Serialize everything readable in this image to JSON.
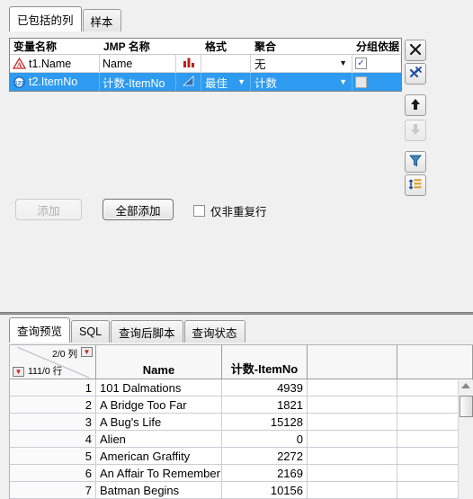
{
  "top_panel": {
    "tabs": [
      {
        "label": "已包括的列",
        "active": true
      },
      {
        "label": "样本",
        "active": false
      }
    ],
    "column_grid": {
      "headers": {
        "variable_name": "变量名称",
        "jmp_name": "JMP 名称",
        "icon": "",
        "format": "格式",
        "aggregate": "聚合",
        "group_by": "分组依据"
      },
      "rows": [
        {
          "type_icon": "nominal-character-icon",
          "variable_name": "t1.Name",
          "jmp_name": "Name",
          "dist_icon": "bar-histogram-icon",
          "format": "",
          "aggregate": "无",
          "group_by_checked": true,
          "selected": false
        },
        {
          "type_icon": "continuous-numeric-icon",
          "variable_name": "t2.ItemNo",
          "jmp_name": "计数-ItemNo",
          "dist_icon": "triangle-distribution-icon",
          "format": "最佳",
          "aggregate": "计数",
          "group_by_checked": false,
          "selected": true
        }
      ]
    },
    "side_buttons": [
      {
        "name": "remove-column-button",
        "icon": "x-icon",
        "disabled": false
      },
      {
        "name": "remove-all-columns-button",
        "icon": "x-multi-icon",
        "disabled": false
      },
      {
        "name": "move-up-button",
        "icon": "arrow-up-icon",
        "disabled": false
      },
      {
        "name": "move-down-button",
        "icon": "arrow-down-icon",
        "disabled": true
      },
      {
        "name": "filter-button",
        "icon": "funnel-icon",
        "disabled": false
      },
      {
        "name": "sort-button",
        "icon": "sort-icon",
        "disabled": false
      }
    ],
    "actions": {
      "add_label": "添加",
      "add_disabled": true,
      "add_all_label": "全部添加",
      "distinct_only_label": "仅非重复行",
      "distinct_only_checked": false
    }
  },
  "bottom_panel": {
    "tabs": [
      {
        "label": "查询预览",
        "active": true
      },
      {
        "label": "SQL",
        "active": false
      },
      {
        "label": "查询后脚本",
        "active": false
      },
      {
        "label": "查询状态",
        "active": false
      }
    ],
    "table": {
      "corner": {
        "columns_text": "2/0 列",
        "rows_text": "111/0 行"
      },
      "headers": [
        "Name",
        "计数-ItemNo",
        "",
        ""
      ],
      "rows": [
        {
          "n": "1",
          "name": "101 Dalmations",
          "count": "4939",
          "e1": "",
          "e2": ""
        },
        {
          "n": "2",
          "name": "A Bridge Too Far",
          "count": "1821",
          "e1": "",
          "e2": ""
        },
        {
          "n": "3",
          "name": "A Bug's Life",
          "count": "15128",
          "e1": "",
          "e2": ""
        },
        {
          "n": "4",
          "name": "Alien",
          "count": "0",
          "e1": "",
          "e2": ""
        },
        {
          "n": "5",
          "name": "American Graffity",
          "count": "2272",
          "e1": "",
          "e2": ""
        },
        {
          "n": "6",
          "name": "An Affair To Remember",
          "count": "2169",
          "e1": "",
          "e2": ""
        },
        {
          "n": "7",
          "name": "Batman Begins",
          "count": "10156",
          "e1": "",
          "e2": ""
        }
      ]
    }
  },
  "colors": {
    "selection_blue": "#2e9bf0",
    "nominal_red": "#c62828",
    "continuous_blue": "#1565c0",
    "red_triangle": "#d02020"
  }
}
